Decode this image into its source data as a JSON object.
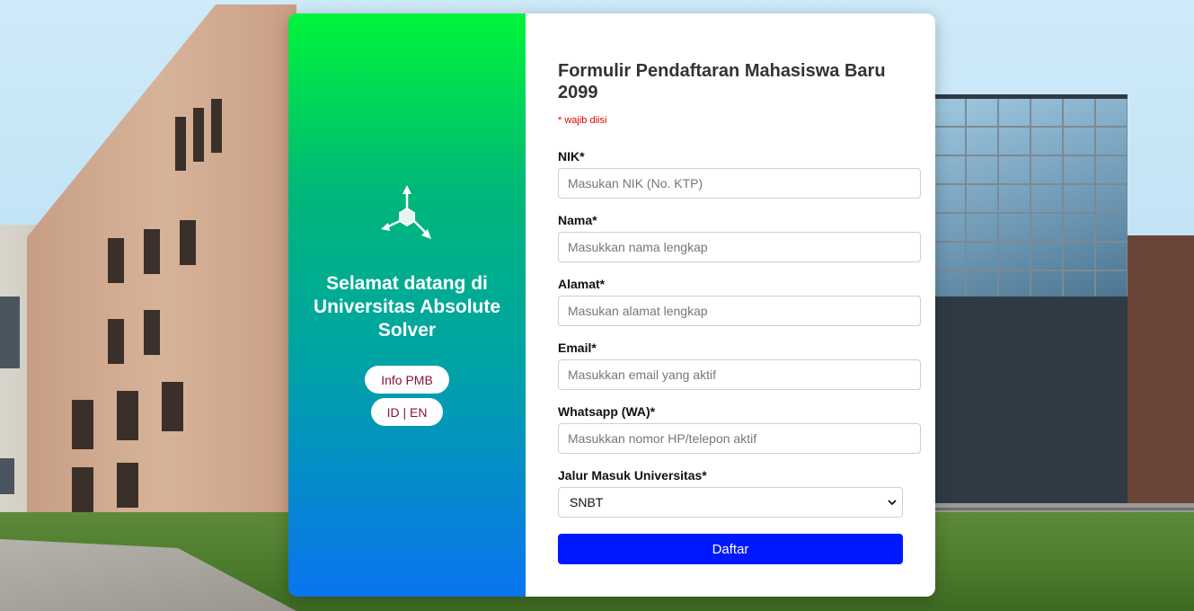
{
  "welcome": {
    "heading": "Selamat datang di Universitas Absolute Solver",
    "buttons": [
      {
        "label": "Info PMB"
      },
      {
        "label": "ID | EN"
      }
    ]
  },
  "form": {
    "title": "Formulir Pendaftaran Mahasiswa Baru 2099",
    "required_note": "* wajib diisi",
    "fields": [
      {
        "label": "NIK*",
        "placeholder": "Masukan NIK (No. KTP)"
      },
      {
        "label": "Nama*",
        "placeholder": "Masukkan nama lengkap"
      },
      {
        "label": "Alamat*",
        "placeholder": "Masukan alamat lengkap"
      },
      {
        "label": "Email*",
        "placeholder": "Masukkan email yang aktif"
      },
      {
        "label": "Whatsapp (WA)*",
        "placeholder": "Masukkan nomor HP/telepon aktif"
      }
    ],
    "select": {
      "label": "Jalur Masuk Universitas*",
      "value": "SNBT"
    },
    "submit_label": "Daftar"
  },
  "colors": {
    "panel_gradient_top": "#00f53a",
    "panel_gradient_bottom": "#0a74f0",
    "submit_button": "#0018ff",
    "required_text": "#e00000",
    "pill_text": "#8a1240"
  },
  "icons": {
    "logo": "molecule-logo-icon",
    "dropdown": "chevron-down-icon"
  }
}
